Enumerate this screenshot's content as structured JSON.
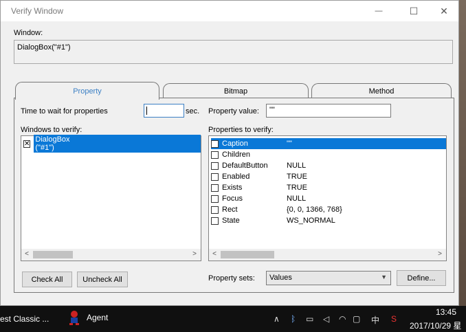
{
  "window": {
    "title": "Verify Window",
    "min_glyph": "—",
    "max_glyph": "☐",
    "close_glyph": "✕"
  },
  "window_section": {
    "label": "Window:",
    "value": "DialogBox(\"#1\")"
  },
  "tabs": [
    {
      "label": "Property",
      "active": true
    },
    {
      "label": "Bitmap",
      "active": false
    },
    {
      "label": "Method",
      "active": false
    }
  ],
  "property_tab": {
    "time_label": "Time to wait for properties",
    "time_value": "",
    "time_unit": "sec.",
    "property_value_label": "Property value:",
    "property_value": "\"\"",
    "windows_label": "Windows to verify:",
    "windows": [
      {
        "label": "DialogBox (\"#1\")",
        "checked": true,
        "selected": true,
        "check_glyph": "✕"
      }
    ],
    "properties_label": "Properties to verify:",
    "properties": [
      {
        "name": "Caption",
        "value": "\"\"",
        "selected": true
      },
      {
        "name": "Children",
        "value": ""
      },
      {
        "name": "DefaultButton",
        "value": "NULL"
      },
      {
        "name": "Enabled",
        "value": "TRUE"
      },
      {
        "name": "Exists",
        "value": "TRUE"
      },
      {
        "name": "Focus",
        "value": "NULL"
      },
      {
        "name": "Rect",
        "value": "{0, 0, 1366, 768}"
      },
      {
        "name": "State",
        "value": "WS_NORMAL"
      }
    ],
    "check_all_label": "Check All",
    "uncheck_all_label": "Uncheck All",
    "property_sets_label": "Property sets:",
    "property_sets_value": "Values",
    "define_label": "Define..."
  },
  "scroll": {
    "left_arrow": "<",
    "right_arrow": ">"
  },
  "taskbar": {
    "app1": "est Classic ...",
    "app2": "Agent",
    "tray_text": "中",
    "time": "13:45",
    "date": "2017/10/29 星"
  }
}
